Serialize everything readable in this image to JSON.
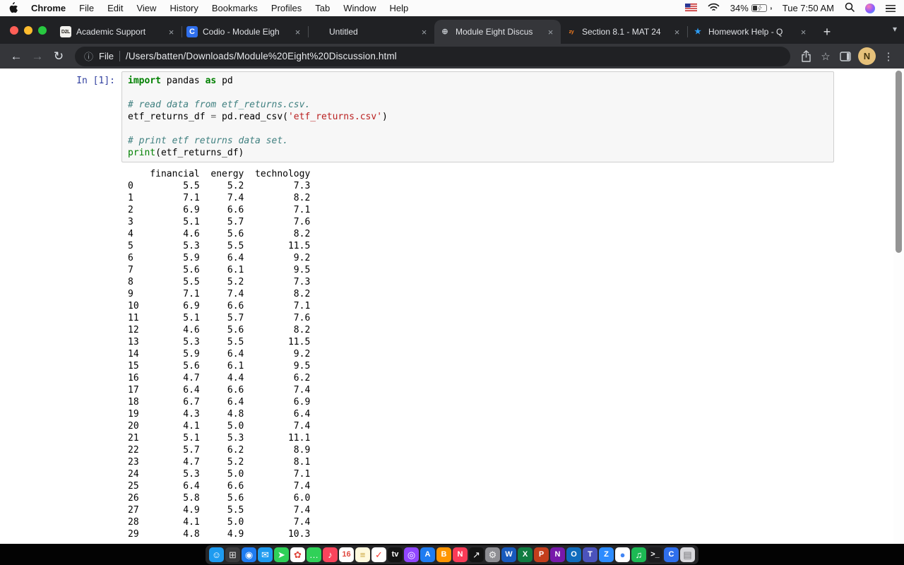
{
  "menubar": {
    "app_name": "Chrome",
    "items": [
      "File",
      "Edit",
      "View",
      "History",
      "Bookmarks",
      "Profiles",
      "Tab",
      "Window",
      "Help"
    ],
    "battery_percent": "34%",
    "clock": "Tue 7:50 AM"
  },
  "tabstrip": {
    "close_glyph": "×",
    "new_tab_glyph": "+",
    "tab_search_glyph": "▾",
    "tabs": [
      {
        "label": "Academic Support",
        "glyph": "D2L",
        "glyph_bg": "#f2f1ee",
        "glyph_color": "#33302b",
        "active": false
      },
      {
        "label": "Codio - Module Eigh",
        "glyph": "C",
        "glyph_bg": "#2f6fed",
        "glyph_color": "#ffffff",
        "active": false
      },
      {
        "label": "Untitled",
        "glyph": "",
        "glyph_bg": "",
        "glyph_color": "",
        "active": false
      },
      {
        "label": "Module Eight Discus",
        "glyph": "⊕",
        "glyph_bg": "transparent",
        "glyph_color": "#bdc1c6",
        "active": true
      },
      {
        "label": "Section 8.1 - MAT 24",
        "glyph": "zy",
        "glyph_bg": "transparent",
        "glyph_color": "#f57c1f",
        "active": false
      },
      {
        "label": "Homework Help - Q",
        "glyph": "★",
        "glyph_bg": "transparent",
        "glyph_color": "#2d9cf4",
        "active": false
      }
    ]
  },
  "toolbar": {
    "back_glyph": "←",
    "forward_glyph": "→",
    "reload_glyph": "↻",
    "info_glyph": "ⓘ",
    "scheme_label": "File",
    "url": "/Users/batten/Downloads/Module%20Eight%20Discussion.html",
    "star_glyph": "☆",
    "menu_glyph": "⋮",
    "avatar_initial": "N"
  },
  "notebook": {
    "prompt": "In [1]:",
    "code_lines": [
      [
        [
          "k",
          "import"
        ],
        [
          "t",
          " pandas "
        ],
        [
          "k",
          "as"
        ],
        [
          "t",
          " pd"
        ]
      ],
      [],
      [
        [
          "c",
          "# read data from etf_returns.csv."
        ]
      ],
      [
        [
          "t",
          "etf_returns_df "
        ],
        [
          "o",
          "="
        ],
        [
          "t",
          " pd.read_csv("
        ],
        [
          "s",
          "'etf_returns.csv'"
        ],
        [
          "t",
          ")"
        ]
      ],
      [],
      [
        [
          "c",
          "# print etf returns data set."
        ]
      ],
      [
        [
          "nb",
          "print"
        ],
        [
          "t",
          "(etf_returns_df)"
        ]
      ]
    ],
    "output_header": [
      "financial",
      "energy",
      "technology"
    ],
    "output_col_widths": [
      2,
      9,
      6,
      10
    ],
    "output_rows": [
      [
        "0",
        "5.5",
        "5.2",
        "7.3"
      ],
      [
        "1",
        "7.1",
        "7.4",
        "8.2"
      ],
      [
        "2",
        "6.9",
        "6.6",
        "7.1"
      ],
      [
        "3",
        "5.1",
        "5.7",
        "7.6"
      ],
      [
        "4",
        "4.6",
        "5.6",
        "8.2"
      ],
      [
        "5",
        "5.3",
        "5.5",
        "11.5"
      ],
      [
        "6",
        "5.9",
        "6.4",
        "9.2"
      ],
      [
        "7",
        "5.6",
        "6.1",
        "9.5"
      ],
      [
        "8",
        "5.5",
        "5.2",
        "7.3"
      ],
      [
        "9",
        "7.1",
        "7.4",
        "8.2"
      ],
      [
        "10",
        "6.9",
        "6.6",
        "7.1"
      ],
      [
        "11",
        "5.1",
        "5.7",
        "7.6"
      ],
      [
        "12",
        "4.6",
        "5.6",
        "8.2"
      ],
      [
        "13",
        "5.3",
        "5.5",
        "11.5"
      ],
      [
        "14",
        "5.9",
        "6.4",
        "9.2"
      ],
      [
        "15",
        "5.6",
        "6.1",
        "9.5"
      ],
      [
        "16",
        "4.7",
        "4.4",
        "6.2"
      ],
      [
        "17",
        "6.4",
        "6.6",
        "7.4"
      ],
      [
        "18",
        "6.7",
        "6.4",
        "6.9"
      ],
      [
        "19",
        "4.3",
        "4.8",
        "6.4"
      ],
      [
        "20",
        "4.1",
        "5.0",
        "7.4"
      ],
      [
        "21",
        "5.1",
        "5.3",
        "11.1"
      ],
      [
        "22",
        "5.7",
        "6.2",
        "8.9"
      ],
      [
        "23",
        "4.7",
        "5.2",
        "8.1"
      ],
      [
        "24",
        "5.3",
        "5.0",
        "7.1"
      ],
      [
        "25",
        "6.4",
        "6.6",
        "7.4"
      ],
      [
        "26",
        "5.8",
        "5.6",
        "6.0"
      ],
      [
        "27",
        "4.9",
        "5.5",
        "7.4"
      ],
      [
        "28",
        "4.1",
        "5.0",
        "7.4"
      ],
      [
        "29",
        "4.8",
        "4.9",
        "10.3"
      ]
    ]
  },
  "dock": {
    "items": [
      {
        "g": "☺",
        "bg": "#1e9bf0",
        "c": "#ffffff",
        "name": "finder"
      },
      {
        "g": "⊞",
        "bg": "#3a3a3c",
        "c": "#dddddd",
        "name": "launchpad"
      },
      {
        "g": "◉",
        "bg": "#1f7cf1",
        "c": "#ffffff",
        "name": "safari"
      },
      {
        "g": "✉",
        "bg": "#1e9bf0",
        "c": "#ffffff",
        "name": "mail"
      },
      {
        "g": "➤",
        "bg": "#30d158",
        "c": "#ffffff",
        "name": "maps"
      },
      {
        "g": "✿",
        "bg": "#ffffff",
        "c": "#e0483e",
        "name": "photos"
      },
      {
        "g": "…",
        "bg": "#30d158",
        "c": "#ffffff",
        "name": "messages"
      },
      {
        "g": "♪",
        "bg": "#fa445c",
        "c": "#ffffff",
        "name": "music"
      },
      {
        "g": "16",
        "bg": "#ffffff",
        "c": "#e0483e",
        "name": "calendar"
      },
      {
        "g": "≡",
        "bg": "#fff9dd",
        "c": "#caa53d",
        "name": "notes"
      },
      {
        "g": "✓",
        "bg": "#ffffff",
        "c": "#fa3b30",
        "name": "reminders"
      },
      {
        "g": "tv",
        "bg": "#141414",
        "c": "#ffffff",
        "name": "tv"
      },
      {
        "g": "◎",
        "bg": "#9146ff",
        "c": "#ffffff",
        "name": "podcasts"
      },
      {
        "g": "A",
        "bg": "#1f7cf1",
        "c": "#ffffff",
        "name": "app-store"
      },
      {
        "g": "B",
        "bg": "#ff9500",
        "c": "#ffffff",
        "name": "books"
      },
      {
        "g": "N",
        "bg": "#fa3b57",
        "c": "#ffffff",
        "name": "news"
      },
      {
        "g": "↗",
        "bg": "#141414",
        "c": "#ffffff",
        "name": "stocks"
      },
      {
        "g": "⚙",
        "bg": "#8e8e93",
        "c": "#f2f2f2",
        "name": "settings"
      },
      {
        "g": "W",
        "bg": "#185abd",
        "c": "#ffffff",
        "name": "word"
      },
      {
        "g": "X",
        "bg": "#107c41",
        "c": "#ffffff",
        "name": "excel"
      },
      {
        "g": "P",
        "bg": "#c43e1c",
        "c": "#ffffff",
        "name": "powerpoint"
      },
      {
        "g": "N",
        "bg": "#7719aa",
        "c": "#ffffff",
        "name": "onenote"
      },
      {
        "g": "O",
        "bg": "#0f6cbd",
        "c": "#ffffff",
        "name": "outlook"
      },
      {
        "g": "T",
        "bg": "#4b53bc",
        "c": "#ffffff",
        "name": "teams"
      },
      {
        "g": "Z",
        "bg": "#2d8cff",
        "c": "#ffffff",
        "name": "zoom"
      },
      {
        "g": "●",
        "bg": "#ffffff",
        "c": "#4285f4",
        "name": "chrome"
      },
      {
        "g": "♫",
        "bg": "#1db954",
        "c": "#ffffff",
        "name": "spotify"
      },
      {
        "g": ">_",
        "bg": "#1c1c1e",
        "c": "#ffffff",
        "name": "terminal"
      },
      {
        "g": "C",
        "bg": "#2f6fed",
        "c": "#ffffff",
        "name": "codio"
      },
      {
        "g": "▤",
        "bg": "#d8d8dc",
        "c": "#76767a",
        "name": "trash"
      }
    ]
  }
}
